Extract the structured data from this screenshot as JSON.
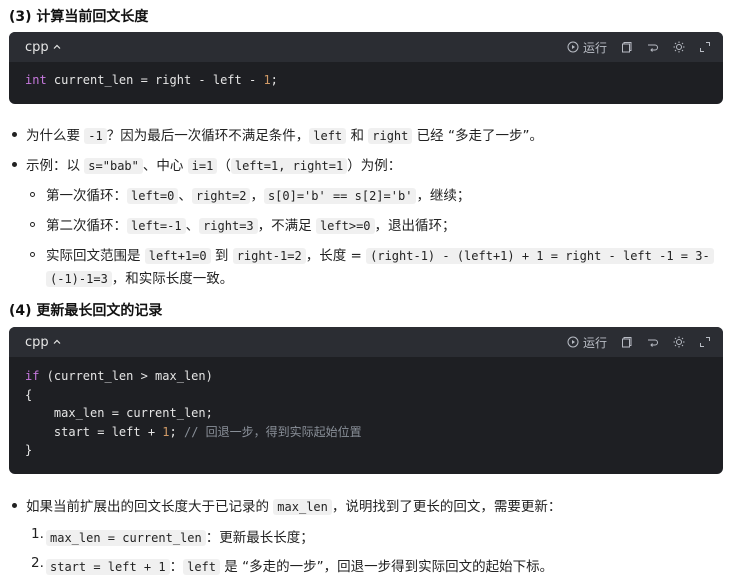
{
  "section3": {
    "heading": "(3) 计算当前回文长度",
    "code": {
      "lang": "cpp",
      "run_label": "运行",
      "line1_kw": "int",
      "line1_a": " current_len = right - left - ",
      "line1_num": "1",
      "line1_b": ";"
    },
    "bullets": {
      "b1_a": "为什么要 ",
      "b1_c1": "-1",
      "b1_b": "？因为最后一次循环不满足条件，",
      "b1_c2": "left",
      "b1_mid": " 和 ",
      "b1_c3": "right",
      "b1_end": " 已经 “多走了一步”。",
      "b2_a": "示例：以 ",
      "b2_c1": "s=\"bab\"",
      "b2_b": "、中心 ",
      "b2_c2": "i=1",
      "b2_c": "（",
      "b2_c3": "left=1, right=1",
      "b2_d": "）为例：",
      "s1_a": "第一次循环：",
      "s1_c1": "left=0",
      "s1_b": "、",
      "s1_c2": "right=2",
      "s1_c": "，",
      "s1_c3": "s[0]='b' == s[2]='b'",
      "s1_d": "，继续；",
      "s2_a": "第二次循环：",
      "s2_c1": "left=-1",
      "s2_b": "、",
      "s2_c2": "right=3",
      "s2_c": "，不满足 ",
      "s2_c3": "left>=0",
      "s2_d": "，退出循环；",
      "s3_a": "实际回文范围是 ",
      "s3_c1": "left+1=0",
      "s3_b": " 到 ",
      "s3_c2": "right-1=2",
      "s3_c": "，长度 = ",
      "s3_c3": "(right-1) - (left+1) + 1 = right - left -1 = 3-",
      "s3_c4": "(-1)-1=3",
      "s3_d": "，和实际长度一致。"
    }
  },
  "section4": {
    "heading": "(4) 更新最长回文的记录",
    "code": {
      "lang": "cpp",
      "run_label": "运行",
      "l1_kw": "if",
      "l1_rest": " (current_len > max_len)",
      "l2": "{",
      "l3": "    max_len = current_len;",
      "l4_a": "    start = left + ",
      "l4_num": "1",
      "l4_b": "; ",
      "l4_cmt": "// 回退一步，得到实际起始位置",
      "l5": "}"
    },
    "bullets": {
      "b1_a": "如果当前扩展出的回文长度大于已记录的 ",
      "b1_c1": "max_len",
      "b1_b": "，说明找到了更长的回文，需要更新：",
      "n1_marker": "1.",
      "n1_c1": "max_len = current_len",
      "n1_a": "：更新最长长度；",
      "n2_marker": "2.",
      "n2_c1": "start = left + 1",
      "n2_a": "：",
      "n2_c2": "left",
      "n2_b": " 是 “多走的一步”，回退一步得到实际回文的起始下标。"
    }
  }
}
